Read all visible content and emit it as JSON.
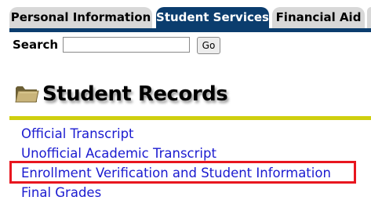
{
  "tabs": [
    {
      "label": "Personal Information",
      "active": false
    },
    {
      "label": "Student Services",
      "active": true
    },
    {
      "label": "Financial Aid",
      "active": false
    }
  ],
  "search": {
    "label": "Search",
    "value": "",
    "button_label": "Go"
  },
  "page": {
    "title": "Student Records",
    "title_icon": "folder-icon"
  },
  "links": [
    {
      "label": "Official Transcript"
    },
    {
      "label": "Unofficial Academic Transcript"
    },
    {
      "label": "Enrollment Verification and Student Information",
      "highlighted": true
    },
    {
      "label": "Final Grades"
    }
  ],
  "colors": {
    "tab_active": "#0b3d6e",
    "tab_inactive": "#d8d8d8",
    "link": "#1b1bd0",
    "divider": "#cfcf0e",
    "highlight_border": "#e8161f"
  }
}
